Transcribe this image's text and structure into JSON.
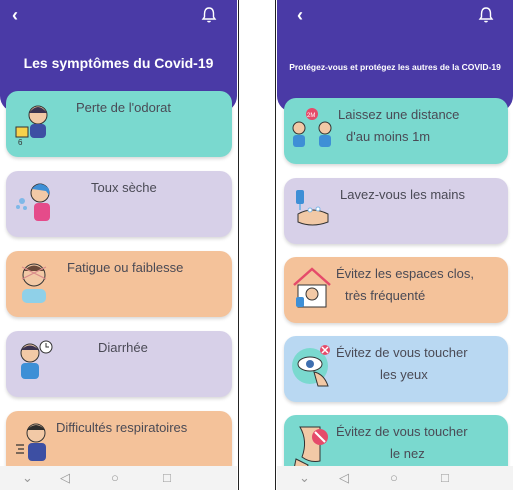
{
  "left": {
    "title": "Les symptômes du Covid-19",
    "back_icon": "chevron-left-icon",
    "bell_icon": "bell-icon",
    "cards": [
      {
        "label": "Perte de l'odorat",
        "color": "#7ad9cf"
      },
      {
        "label": "Toux sèche",
        "color": "#d7d0e8"
      },
      {
        "label": "Fatigue ou faiblesse",
        "color": "#f4c29a"
      },
      {
        "label": "Diarrhée",
        "color": "#d7d0e8"
      },
      {
        "label": "Difficultés respiratoires",
        "color": "#f4c29a"
      }
    ]
  },
  "right": {
    "title": "Protégez-vous et protégez les autres de la COVID-19",
    "cards": [
      {
        "line1": "Laissez une distance",
        "line2": "d'au moins 1m",
        "color": "#7ad9cf"
      },
      {
        "line1": "Lavez-vous les mains",
        "line2": "",
        "color": "#d7d0e8"
      },
      {
        "line1": "Évitez les espaces clos,",
        "line2": "très fréquenté",
        "color": "#f4c29a"
      },
      {
        "line1": "Évitez de vous toucher",
        "line2": "les yeux",
        "color": "#b9d8f2"
      },
      {
        "line1": "Évitez de vous toucher",
        "line2": "le nez",
        "color": "#7ad9cf"
      }
    ]
  },
  "colors": {
    "header": "#4a3aa6",
    "text": "#4a4a55"
  },
  "navbar": [
    "chevron-down-icon",
    "back-triangle-icon",
    "home-circle-icon",
    "recents-square-icon"
  ]
}
